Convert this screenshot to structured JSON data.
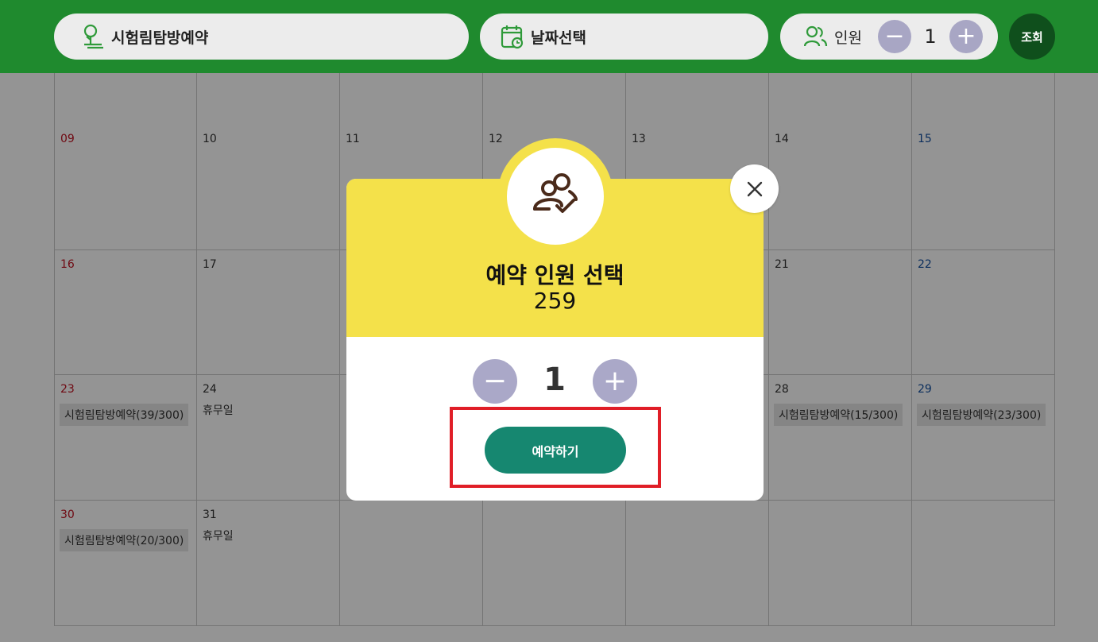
{
  "header": {
    "program_label": "시험림탐방예약",
    "date_label": "날짜선택",
    "people_label": "인원",
    "people_count": "1",
    "minus": "−",
    "plus": "+",
    "search_label": "조회"
  },
  "calendar": {
    "rows": [
      [
        {
          "day": "",
          "kind": "sun"
        },
        {
          "day": ""
        },
        {
          "day": ""
        },
        {
          "day": ""
        },
        {
          "day": ""
        },
        {
          "day": ""
        },
        {
          "day": "",
          "kind": "sat"
        }
      ],
      [
        {
          "day": "09",
          "kind": "sun"
        },
        {
          "day": "10"
        },
        {
          "day": "11"
        },
        {
          "day": "12"
        },
        {
          "day": "13"
        },
        {
          "day": "14"
        },
        {
          "day": "15",
          "kind": "sat"
        }
      ],
      [
        {
          "day": "16",
          "kind": "sun"
        },
        {
          "day": "17"
        },
        {
          "day": ""
        },
        {
          "day": ""
        },
        {
          "day": ""
        },
        {
          "day": "21"
        },
        {
          "day": "22",
          "kind": "sat"
        }
      ],
      [
        {
          "day": "23",
          "kind": "sun",
          "tag": "시험림탐방예약(39/300)"
        },
        {
          "day": "24",
          "note": "휴무일"
        },
        {
          "day": ""
        },
        {
          "day": ""
        },
        {
          "day": ""
        },
        {
          "day": "28",
          "tag": "시험림탐방예약(15/300)"
        },
        {
          "day": "29",
          "kind": "sat",
          "tag": "시험림탐방예약(23/300)"
        }
      ],
      [
        {
          "day": "30",
          "kind": "sun",
          "tag": "시험림탐방예약(20/300)"
        },
        {
          "day": "31",
          "note": "휴무일"
        },
        {
          "day": ""
        },
        {
          "day": ""
        },
        {
          "day": ""
        },
        {
          "day": ""
        },
        {
          "day": ""
        }
      ]
    ]
  },
  "modal": {
    "title": "예약 인원 선택",
    "subtitle": "259",
    "count": "1",
    "minus": "−",
    "plus": "+",
    "reserve_label": "예약하기",
    "close_icon": "close-icon",
    "badge_icon": "people-check-icon",
    "highlight_color": "#e01e27",
    "accent_color": "#f4e14a",
    "button_color": "#168770"
  }
}
